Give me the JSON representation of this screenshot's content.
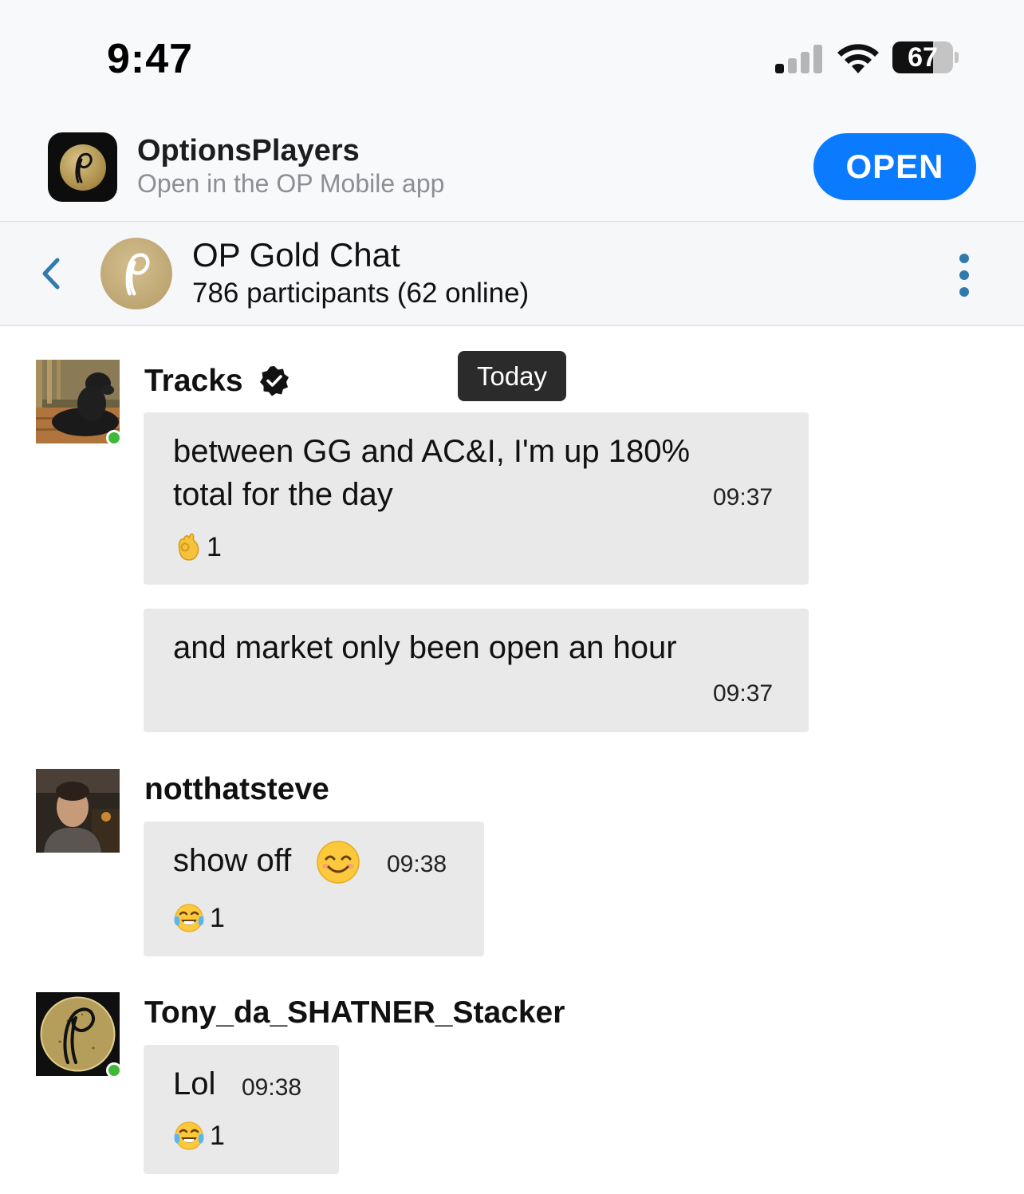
{
  "status_bar": {
    "time": "9:47",
    "battery": "67",
    "battery_level": 0.67
  },
  "app_banner": {
    "app_name": "OptionsPlayers",
    "subtitle": "Open in the OP Mobile app",
    "open_label": "OPEN",
    "open_color": "#0a7aff"
  },
  "chat_header": {
    "title": "OP Gold Chat",
    "subtitle": "786 participants (62 online)",
    "back_icon": "chevron-left-icon",
    "menu_icon": "kebab-menu-icon"
  },
  "day_separator": "Today",
  "messages": [
    {
      "author": "Tracks",
      "verified": true,
      "online": true,
      "bubbles": [
        {
          "text": "between GG and AC&I, I'm up 180% total for the day",
          "line1": "between GG and AC&I, I'm up 180%",
          "line2": "total for the day",
          "time": "09:37",
          "reaction": {
            "emoji": "ok-hand-emoji",
            "count": "1"
          }
        },
        {
          "text": "and market only been open an hour",
          "time": "09:37"
        }
      ]
    },
    {
      "author": "notthatsteve",
      "verified": false,
      "online": false,
      "bubbles": [
        {
          "text": "show off",
          "emoji": "smiling-face-emoji",
          "time": "09:38",
          "reaction": {
            "emoji": "tears-of-joy-emoji",
            "count": "1"
          }
        }
      ]
    },
    {
      "author": "Tony_da_SHATNER_Stacker",
      "verified": false,
      "online": true,
      "bubbles": [
        {
          "text": "Lol",
          "time": "09:38",
          "reaction": {
            "emoji": "tears-of-joy-emoji",
            "count": "1"
          }
        }
      ]
    }
  ],
  "colors": {
    "bubble": "#e9e9ea",
    "online": "#3fba38",
    "accent_blue": "#2f7bad"
  }
}
